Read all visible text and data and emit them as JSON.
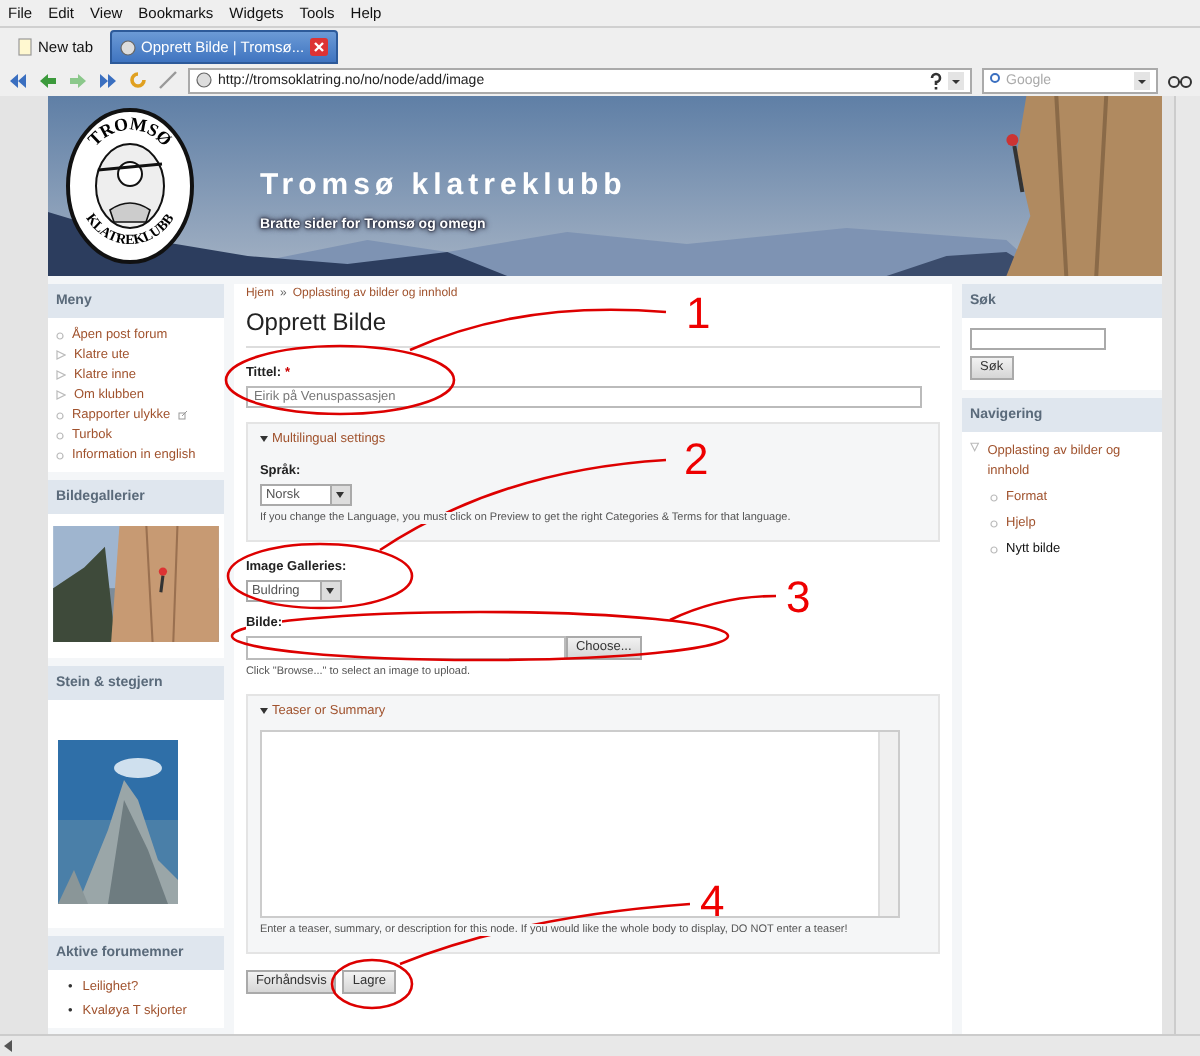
{
  "browser": {
    "menu": [
      "File",
      "Edit",
      "View",
      "Bookmarks",
      "Widgets",
      "Tools",
      "Help"
    ],
    "tabs": [
      {
        "label": "New tab",
        "selected": false
      },
      {
        "label": "Opprett Bilde | Tromsø...",
        "selected": true
      }
    ],
    "address": "http://tromsoklatring.no/no/node/add/image",
    "search_placeholder": "Google"
  },
  "site": {
    "logo_top": "TROMSØ",
    "logo_bottom": "KLATREKLUBB",
    "title": "Tromsø klatreklubb",
    "slogan": "Bratte sider for Tromsø og omegn"
  },
  "left_sidebar": [
    {
      "title": "Meny",
      "kind": "menu",
      "items": [
        {
          "label": "Åpen post forum",
          "expandable": false,
          "external": false
        },
        {
          "label": "Klatre ute",
          "expandable": true,
          "external": false
        },
        {
          "label": "Klatre inne",
          "expandable": true,
          "external": false
        },
        {
          "label": "Om klubben",
          "expandable": true,
          "external": false
        },
        {
          "label": "Rapporter ulykke",
          "expandable": false,
          "external": true
        },
        {
          "label": "Turbok",
          "expandable": false,
          "external": false
        },
        {
          "label": "Information in english",
          "expandable": false,
          "external": false
        }
      ]
    },
    {
      "title": "Bildegallerier"
    },
    {
      "title": "Stein & stegjern",
      "kind": "cover"
    },
    {
      "title": "Aktive forumemner",
      "kind": "bullets",
      "marker": "•",
      "items": [
        {
          "label": "Leilighet?"
        },
        {
          "label": "Kvaløya T skjorter"
        }
      ]
    }
  ],
  "main": {
    "breadcrumb": [
      "Hjem",
      "Opplasting av bilder og innhold"
    ],
    "breadcrumb_separator": "»",
    "title": "Opprett Bilde",
    "title_field": {
      "label": "Tittel:",
      "required": "*",
      "value": "Eirik på Venuspassasjen"
    },
    "multilingual": {
      "legend": "Multilingual settings",
      "expanded": true,
      "label": "Språk:",
      "value": "Norsk",
      "help": "If you change the Language, you must click on Preview to get the right Categories & Terms for that language."
    },
    "galleries": {
      "label": "Image Galleries:",
      "value": "Buldring"
    },
    "image": {
      "label": "Bilde:",
      "button": "Choose...",
      "help": "Click \"Browse...\" to select an image to upload."
    },
    "teaser": {
      "legend": "Teaser or Summary",
      "expanded": true,
      "help": "Enter a teaser, summary, or description for this node. If you would like the whole body to display, DO NOT enter a teaser!"
    },
    "buttons": [
      "Forhåndsvis",
      "Lagre"
    ]
  },
  "right_sidebar": {
    "search": {
      "title": "Søk",
      "button": "Søk"
    },
    "navigation": {
      "title": "Navigering",
      "items": [
        {
          "label": "Opplasting av bilder og innhold",
          "expanded": true,
          "selected": false,
          "children": [
            {
              "label": "Format",
              "selected": false
            },
            {
              "label": "Hjelp",
              "selected": false
            },
            {
              "label": "Nytt bilde",
              "selected": true
            }
          ]
        }
      ]
    }
  },
  "annotations": [
    {
      "number": "1"
    },
    {
      "number": "2"
    },
    {
      "number": "3"
    },
    {
      "number": "4"
    }
  ]
}
